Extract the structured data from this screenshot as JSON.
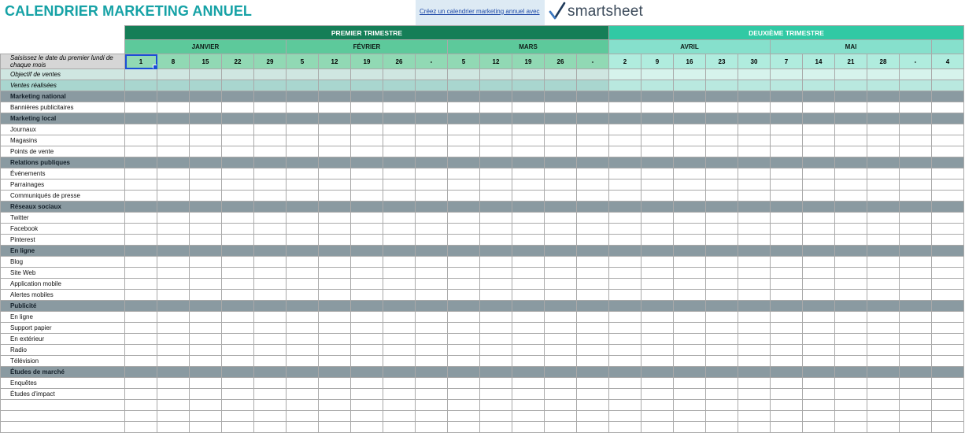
{
  "title": "CALENDRIER MARKETING ANNUEL",
  "promo": {
    "link_text": "Créez un calendrier marketing annuel avec"
  },
  "logo": {
    "text": "smartsheet",
    "icon": "checkmark-icon"
  },
  "instruction": "Saisissez le date du premier lundi de chaque mois",
  "quarters": [
    {
      "label": "PREMIER TRIMESTRE"
    },
    {
      "label": "DEUXIÈME TRIMESTRE"
    }
  ],
  "months": [
    {
      "label": "JANVIER",
      "weeks": [
        "1",
        "8",
        "15",
        "22",
        "29"
      ]
    },
    {
      "label": "FÉVRIER",
      "weeks": [
        "5",
        "12",
        "19",
        "26",
        "-"
      ]
    },
    {
      "label": "MARS",
      "weeks": [
        "5",
        "12",
        "19",
        "26",
        "-"
      ]
    },
    {
      "label": "AVRIL",
      "weeks": [
        "2",
        "9",
        "16",
        "23",
        "30"
      ]
    },
    {
      "label": "MAI",
      "weeks": [
        "7",
        "14",
        "21",
        "28",
        "-"
      ]
    }
  ],
  "next_month_first_week": "4",
  "rows": {
    "objective": "Objectif de ventes",
    "sales": "Ventes réalisées"
  },
  "categories": [
    {
      "label": "Marketing national",
      "items": [
        "Bannières publicitaires"
      ]
    },
    {
      "label": "Marketing local",
      "items": [
        "Journaux",
        "Magasins",
        "Points de vente"
      ]
    },
    {
      "label": "Relations publiques",
      "items": [
        "Événements",
        "Parrainages",
        "Communiqués de presse"
      ]
    },
    {
      "label": "Réseaux sociaux",
      "items": [
        "Twitter",
        "Facebook",
        "Pinterest"
      ]
    },
    {
      "label": "En ligne",
      "items": [
        "Blog",
        "Site Web",
        "Application mobile",
        "Alertes mobiles"
      ]
    },
    {
      "label": "Publicité",
      "items": [
        "En ligne",
        "Support papier",
        "En extérieur",
        "Radio",
        "Télévision"
      ]
    },
    {
      "label": "Études de marché",
      "items": [
        "Enquêtes",
        "Études d'impact",
        "",
        "",
        ""
      ]
    }
  ],
  "colors": {
    "title": "#16a2a6",
    "quarter_1": "#157e57",
    "quarter_2": "#31c9a4",
    "category_row": "#8a9aa1",
    "selection": "#1b4fd6"
  }
}
